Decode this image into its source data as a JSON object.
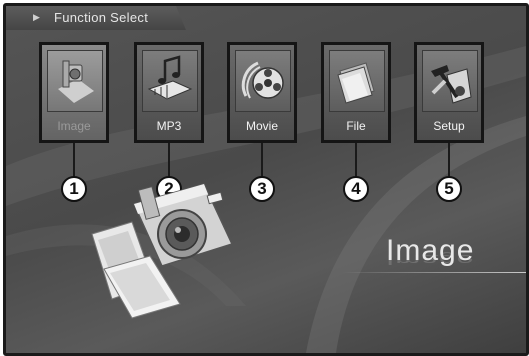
{
  "header": {
    "title": "Function Select"
  },
  "menu": {
    "items": [
      {
        "label": "Image",
        "icon": "image-icon",
        "selected": true
      },
      {
        "label": "MP3",
        "icon": "mp3-icon",
        "selected": false
      },
      {
        "label": "Movie",
        "icon": "movie-reel-icon",
        "selected": false
      },
      {
        "label": "File",
        "icon": "file-icon",
        "selected": false
      },
      {
        "label": "Setup",
        "icon": "setup-tools-icon",
        "selected": false
      }
    ]
  },
  "callouts": [
    "1",
    "2",
    "3",
    "4",
    "5"
  ],
  "current": {
    "title": "Image"
  },
  "colors": {
    "background": "#4f4f4f",
    "border": "#1a1a1a",
    "text": "#f2f2f2"
  }
}
